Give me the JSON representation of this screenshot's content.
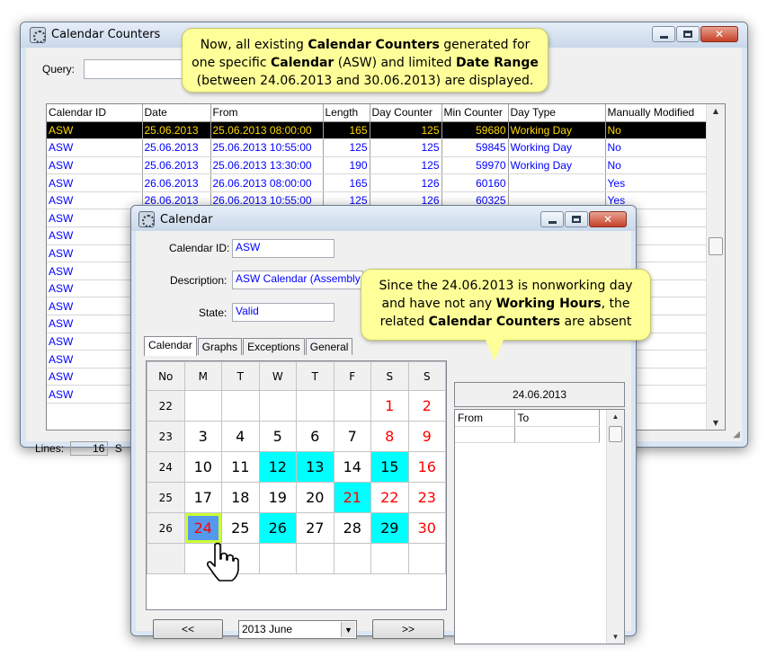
{
  "main_window": {
    "title": "Calendar Counters",
    "query_label": "Query:",
    "query_value": "",
    "columns": [
      "Calendar ID",
      "Date",
      "From",
      "Length",
      "Day Counter",
      "Min Counter",
      "Day Type",
      "Manually Modified"
    ],
    "rows": [
      [
        "ASW",
        "25.06.2013",
        "25.06.2013 08:00:00",
        "165",
        "125",
        "59680",
        "Working Day",
        "No"
      ],
      [
        "ASW",
        "25.06.2013",
        "25.06.2013 10:55:00",
        "125",
        "125",
        "59845",
        "Working Day",
        "No"
      ],
      [
        "ASW",
        "25.06.2013",
        "25.06.2013 13:30:00",
        "190",
        "125",
        "59970",
        "Working Day",
        "No"
      ],
      [
        "ASW",
        "26.06.2013",
        "26.06.2013 08:00:00",
        "165",
        "126",
        "60160",
        "",
        "Yes"
      ],
      [
        "ASW",
        "26.06.2013",
        "26.06.2013 10:55:00",
        "125",
        "126",
        "60325",
        "",
        "Yes"
      ],
      [
        "ASW",
        "",
        "",
        "",
        "",
        "",
        "",
        ""
      ],
      [
        "ASW",
        "",
        "",
        "",
        "",
        "",
        "",
        ""
      ],
      [
        "ASW",
        "",
        "",
        "",
        "",
        "",
        "",
        ""
      ],
      [
        "ASW",
        "",
        "",
        "",
        "",
        "",
        "",
        ""
      ],
      [
        "ASW",
        "",
        "",
        "",
        "",
        "",
        "",
        ""
      ],
      [
        "ASW",
        "",
        "",
        "",
        "",
        "",
        "",
        ""
      ],
      [
        "ASW",
        "",
        "",
        "",
        "",
        "",
        "",
        ""
      ],
      [
        "ASW",
        "",
        "",
        "",
        "",
        "",
        "",
        ""
      ],
      [
        "ASW",
        "",
        "",
        "",
        "",
        "",
        "",
        ""
      ],
      [
        "ASW",
        "",
        "",
        "",
        "",
        "",
        "",
        ""
      ],
      [
        "ASW",
        "",
        "",
        "",
        "",
        "",
        "",
        ""
      ]
    ],
    "selected_row": 0,
    "lines_label": "Lines:",
    "lines_value": "16",
    "status_extra": "S"
  },
  "callout_top": {
    "parts": [
      {
        "t": "Now, all existing ",
        "b": false
      },
      {
        "t": "Calendar Counters",
        "b": true
      },
      {
        "t": " generated for one specific ",
        "b": false
      },
      {
        "t": "Calendar",
        "b": true
      },
      {
        "t": " (ASW) and limited ",
        "b": false
      },
      {
        "t": "Date Range",
        "b": true
      },
      {
        "t": " (between 24.06.2013 and 30.06.2013) are displayed.",
        "b": false
      }
    ]
  },
  "callout_right": {
    "parts": [
      {
        "t": "Since the 24.06.2013 is nonworking day and have not any ",
        "b": false
      },
      {
        "t": "Working Hours",
        "b": true
      },
      {
        "t": ", the related ",
        "b": false
      },
      {
        "t": "Calendar Counters",
        "b": true
      },
      {
        "t": " are absent",
        "b": false
      }
    ]
  },
  "calendar_window": {
    "title": "Calendar",
    "calendar_id_label": "Calendar ID:",
    "calendar_id_value": "ASW",
    "description_label": "Description:",
    "description_value": "ASW Calendar (Assembly S",
    "state_label": "State:",
    "state_value": "Valid",
    "tabs": [
      "Calendar",
      "Graphs",
      "Exceptions",
      "General"
    ],
    "active_tab": "Calendar",
    "week_header": [
      "No",
      "M",
      "T",
      "W",
      "T",
      "F",
      "S",
      "S"
    ],
    "weeks": [
      {
        "no": "22",
        "days": [
          "",
          "",
          "",
          "",
          "",
          "1",
          "2"
        ]
      },
      {
        "no": "23",
        "days": [
          "3",
          "4",
          "5",
          "6",
          "7",
          "8",
          "9"
        ]
      },
      {
        "no": "24",
        "days": [
          "10",
          "11",
          "12",
          "13",
          "14",
          "15",
          "16"
        ]
      },
      {
        "no": "25",
        "days": [
          "17",
          "18",
          "19",
          "20",
          "21",
          "22",
          "23"
        ]
      },
      {
        "no": "26",
        "days": [
          "24",
          "25",
          "26",
          "27",
          "28",
          "29",
          "30"
        ]
      },
      {
        "no": "",
        "days": [
          "",
          "",
          "",
          "",
          "",
          "",
          ""
        ]
      }
    ],
    "highlighted_days": [
      "12",
      "13",
      "15",
      "21",
      "26",
      "29"
    ],
    "red_days": [
      "1",
      "2",
      "8",
      "9",
      "16",
      "21",
      "22",
      "23",
      "24",
      "30"
    ],
    "selected_day": "24",
    "prev_label": "<<",
    "next_label": ">>",
    "month_value": "2013 June",
    "detail_date": "24.06.2013",
    "hours_columns": [
      "From",
      "To"
    ],
    "colors": {
      "highlight": "#00ffff",
      "weekend": "#ff0000",
      "selected": "#5599ee"
    }
  }
}
